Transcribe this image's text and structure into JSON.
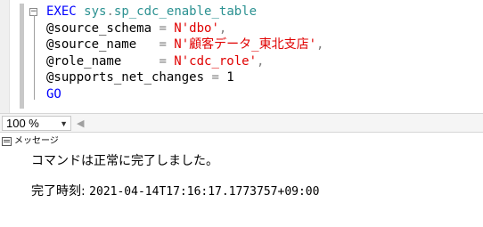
{
  "editor": {
    "collapse_glyph": "−",
    "lines": [
      {
        "parts": [
          {
            "text": "EXEC ",
            "cls": "kw"
          },
          {
            "text": "sys",
            "cls": "obj"
          },
          {
            "text": ".",
            "cls": "op"
          },
          {
            "text": "sp_cdc_enable_table",
            "cls": "obj"
          }
        ]
      },
      {
        "parts": [
          {
            "text": "@source_schema ",
            "cls": "id"
          },
          {
            "text": "= ",
            "cls": "op"
          },
          {
            "text": "N'dbo'",
            "cls": "str red"
          },
          {
            "text": ",",
            "cls": "op"
          }
        ]
      },
      {
        "parts": [
          {
            "text": "@source_name   ",
            "cls": "id"
          },
          {
            "text": "= ",
            "cls": "op"
          },
          {
            "text": "N'顧客データ_東北支店'",
            "cls": "str red"
          },
          {
            "text": ",",
            "cls": "op"
          }
        ]
      },
      {
        "parts": [
          {
            "text": "@role_name     ",
            "cls": "id"
          },
          {
            "text": "= ",
            "cls": "op"
          },
          {
            "text": "N'cdc_role'",
            "cls": "str red"
          },
          {
            "text": ",",
            "cls": "op"
          }
        ]
      },
      {
        "parts": [
          {
            "text": "@supports_net_changes ",
            "cls": "id"
          },
          {
            "text": "= ",
            "cls": "op"
          },
          {
            "text": "1",
            "cls": "id"
          }
        ]
      },
      {
        "parts": [
          {
            "text": "GO",
            "cls": "kw"
          }
        ]
      }
    ]
  },
  "statusbar": {
    "zoom": "100 %",
    "zoom_arrow": "▼",
    "scroll_left_glyph": "◀"
  },
  "results": {
    "tab_label": "メッセージ",
    "message": "コマンドは正常に完了しました。",
    "completion_label": "完了時刻: ",
    "completion_time": "2021-04-14T17:16:17.1773757+09:00"
  }
}
